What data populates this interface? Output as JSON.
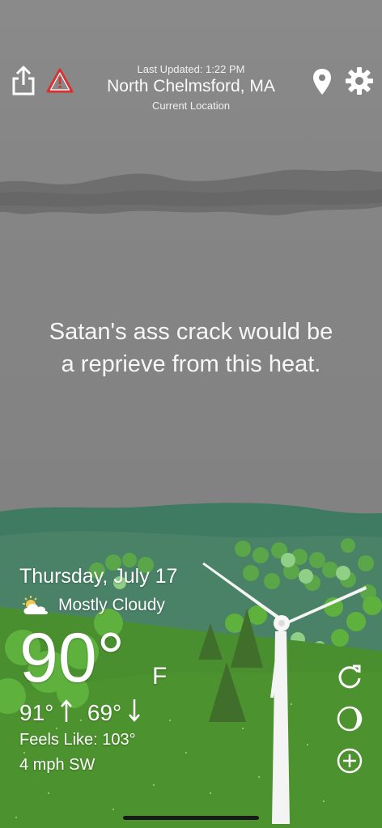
{
  "header": {
    "last_updated": "Last Updated: 1:22 PM",
    "location": "North Chelmsford, MA",
    "location_sub": "Current Location"
  },
  "icons": {
    "share": "share-icon",
    "alert": "warning-triangle-icon",
    "location": "location-pin-icon",
    "settings": "gear-icon",
    "condition": "partly-cloudy-icon",
    "refresh": "refresh-icon",
    "moon": "moon-phase-icon",
    "add": "plus-circle-icon"
  },
  "colors": {
    "sky": "#828282",
    "hill_dark": "#3f7a63",
    "grass": "#4a8f2f",
    "alert_red": "#d93030"
  },
  "quote": {
    "line1": "Satan's ass crack would be",
    "line2": "a reprieve from this heat."
  },
  "weather": {
    "date": "Thursday, July 17",
    "condition": "Mostly Cloudy",
    "temperature": "90°",
    "unit": "F",
    "high": "91°",
    "low": "69°",
    "feels_like": "Feels Like: 103°",
    "wind": "4 mph SW"
  }
}
